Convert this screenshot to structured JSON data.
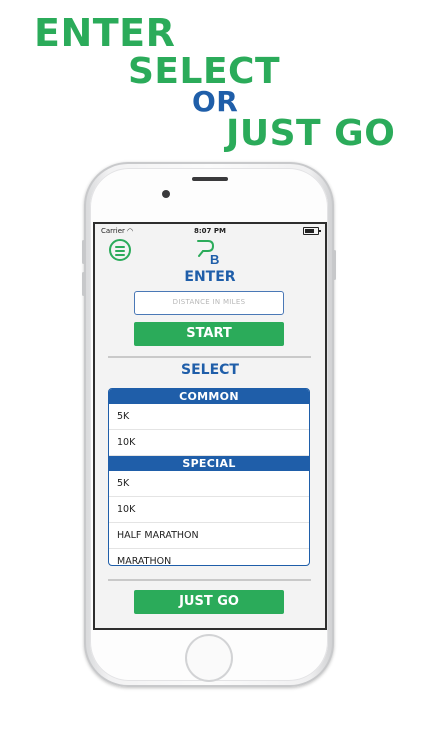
{
  "headline": {
    "line1": "ENTER",
    "line2": "SELECT",
    "line3": "OR",
    "line4": "JUST GO"
  },
  "status_bar": {
    "carrier": "Carrier",
    "time": "8:07 PM"
  },
  "app": {
    "logo_text": "B",
    "enter_title": "ENTER",
    "distance_placeholder": "DISTANCE IN MILES",
    "start_label": "START",
    "select_title": "SELECT",
    "lists": [
      {
        "header": "COMMON",
        "items": [
          "5K",
          "10K"
        ]
      },
      {
        "header": "SPECIAL",
        "items": [
          "5K",
          "10K",
          "HALF MARATHON",
          "MARATHON"
        ]
      }
    ],
    "just_go_label": "JUST GO"
  },
  "colors": {
    "green": "#2bab5a",
    "blue": "#1f5ea9",
    "screen_bg": "#f3f3f3"
  }
}
